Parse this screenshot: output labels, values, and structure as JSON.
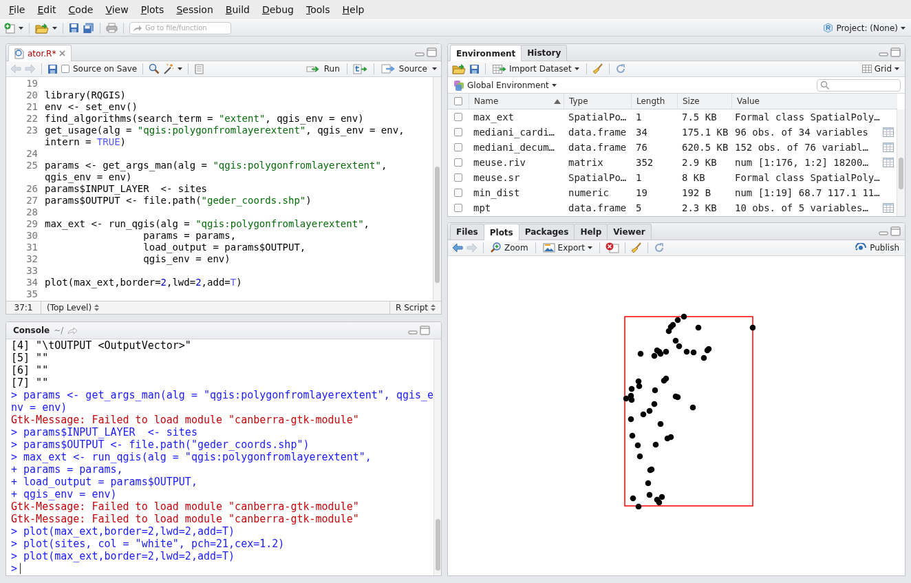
{
  "menu": [
    "File",
    "Edit",
    "Code",
    "View",
    "Plots",
    "Session",
    "Build",
    "Debug",
    "Tools",
    "Help"
  ],
  "main_toolbar": {
    "goto_placeholder": "Go to file/function",
    "project": "Project: (None)"
  },
  "editor": {
    "tabs": [
      {
        "label": "ator.R*",
        "selected": true,
        "modified": true
      }
    ],
    "back_disabled": true,
    "forward_disabled": true,
    "source_on_save": {
      "label": "Source on Save",
      "checked": false
    },
    "run_label": "Run",
    "source_label": "Source",
    "lines": [
      {
        "number": "19"
      },
      {
        "number": "20",
        "segments": [
          {
            "kind": "plain",
            "text": "library(RQGIS)"
          }
        ]
      },
      {
        "number": "21",
        "segments": [
          {
            "kind": "plain",
            "text": "env <- set_env()"
          }
        ]
      },
      {
        "number": "22",
        "segments": [
          {
            "kind": "plain",
            "text": "find_algorithms(search_term = "
          },
          {
            "kind": "string",
            "text": "\"extent\""
          },
          {
            "kind": "plain",
            "text": ", qgis_env = env)"
          }
        ]
      },
      {
        "number": "23",
        "segments": [
          {
            "kind": "plain",
            "text": "get_usage(alg = "
          },
          {
            "kind": "string",
            "text": "\"qgis:polygonfromlayerextent\""
          },
          {
            "kind": "plain",
            "text": ", qgis_env = env, intern = "
          },
          {
            "kind": "constant",
            "text": "TRUE"
          },
          {
            "kind": "plain",
            "text": ")"
          }
        ]
      },
      {
        "number": "24"
      },
      {
        "number": "25",
        "segments": [
          {
            "kind": "plain",
            "text": "params <- get_args_man(alg = "
          },
          {
            "kind": "string",
            "text": "\"qgis:polygonfromlayerextent\""
          },
          {
            "kind": "plain",
            "text": ", qgis_env = env)"
          }
        ]
      },
      {
        "number": "26",
        "segments": [
          {
            "kind": "plain",
            "text": "params$INPUT_LAYER  <- sites"
          }
        ]
      },
      {
        "number": "27",
        "segments": [
          {
            "kind": "plain",
            "text": "params$OUTPUT <- file.path("
          },
          {
            "kind": "string",
            "text": "\"geder_coords.shp\""
          },
          {
            "kind": "plain",
            "text": ")"
          }
        ]
      },
      {
        "number": "28"
      },
      {
        "number": "29",
        "segments": [
          {
            "kind": "plain",
            "text": "max_ext <- run_qgis(alg = "
          },
          {
            "kind": "string",
            "text": "\"qgis:polygonfromlayerextent\""
          },
          {
            "kind": "plain",
            "text": ","
          }
        ]
      },
      {
        "number": "30",
        "segments": [
          {
            "kind": "plain",
            "text": "                 params = params,"
          }
        ]
      },
      {
        "number": "31",
        "segments": [
          {
            "kind": "plain",
            "text": "                 load_output = params$OUTPUT,"
          }
        ]
      },
      {
        "number": "32",
        "segments": [
          {
            "kind": "plain",
            "text": "                 qgis_env = env)"
          }
        ]
      },
      {
        "number": "33"
      },
      {
        "number": "34",
        "segments": [
          {
            "kind": "plain",
            "text": "plot(max_ext,border="
          },
          {
            "kind": "number",
            "text": "2"
          },
          {
            "kind": "plain",
            "text": ",lwd="
          },
          {
            "kind": "number",
            "text": "2"
          },
          {
            "kind": "plain",
            "text": ",add="
          },
          {
            "kind": "constant",
            "text": "T"
          },
          {
            "kind": "plain",
            "text": ")"
          }
        ]
      },
      {
        "number": "35"
      }
    ],
    "status": {
      "position": "37:1",
      "scope": "(Top Level)",
      "file_type": "R Script"
    }
  },
  "console": {
    "title": "Console",
    "path": "~/",
    "lines": [
      {
        "kind": "output",
        "text": "[4] \"\\tOUTPUT <OutputVector>\""
      },
      {
        "kind": "output",
        "text": "[5] \"\""
      },
      {
        "kind": "output",
        "text": "[6] \"\""
      },
      {
        "kind": "output",
        "text": "[7] \"\""
      },
      {
        "kind": "input",
        "text": "> params <- get_args_man(alg = \"qgis:polygonfromlayerextent\", qgis_env = env)"
      },
      {
        "kind": "error",
        "text": "Gtk-Message: Failed to load module \"canberra-gtk-module\""
      },
      {
        "kind": "input",
        "text": "> params$INPUT_LAYER  <- sites"
      },
      {
        "kind": "input",
        "text": "> params$OUTPUT <- file.path(\"geder_coords.shp\")"
      },
      {
        "kind": "input",
        "text": "> max_ext <- run_qgis(alg = \"qgis:polygonfromlayerextent\","
      },
      {
        "kind": "input",
        "text": "+ params = params,"
      },
      {
        "kind": "input",
        "text": "+ load_output = params$OUTPUT,"
      },
      {
        "kind": "input",
        "text": "+ qgis_env = env)"
      },
      {
        "kind": "error",
        "text": "Gtk-Message: Failed to load module \"canberra-gtk-module\""
      },
      {
        "kind": "error",
        "text": "Gtk-Message: Failed to load module \"canberra-gtk-module\""
      },
      {
        "kind": "input",
        "text": "> plot(max_ext,border=2,lwd=2,add=T)"
      },
      {
        "kind": "input",
        "text": "> plot(sites, col = \"white\", pch=21,cex=1.2)"
      },
      {
        "kind": "input",
        "text": "> plot(max_ext,border=2,lwd=2,add=T)"
      },
      {
        "kind": "prompt",
        "text": ">"
      }
    ]
  },
  "environment": {
    "tabs": [
      {
        "label": "Environment",
        "selected": true
      },
      {
        "label": "History",
        "selected": false
      }
    ],
    "import_label": "Import Dataset",
    "view_label": "Grid",
    "scope_label": "Global Environment",
    "all_checked": false,
    "columns": [
      {
        "label": "Name",
        "sorted": true
      },
      {
        "label": "Type"
      },
      {
        "label": "Length"
      },
      {
        "label": "Size"
      },
      {
        "label": "Value"
      }
    ],
    "rows": [
      {
        "name": "max_ext",
        "type": "SpatialPo…",
        "length": "1",
        "size": "7.5 KB",
        "value": "Formal class SpatialPoly…",
        "checked": false,
        "viewable": false
      },
      {
        "name": "mediani_cardi…",
        "type": "data.frame",
        "length": "34",
        "size": "175.1 KB",
        "value": "96 obs. of 34 variables",
        "checked": false,
        "viewable": true
      },
      {
        "name": "mediani_decum…",
        "type": "data.frame",
        "length": "76",
        "size": "620.5 KB",
        "value": "152 obs. of 76 variabl…",
        "checked": false,
        "viewable": true
      },
      {
        "name": "meuse.riv",
        "type": "matrix",
        "length": "352",
        "size": "2.9 KB",
        "value": "num [1:176, 1:2] 18200…",
        "checked": false,
        "viewable": true
      },
      {
        "name": "meuse.sr",
        "type": "SpatialPo…",
        "length": "1",
        "size": "8 KB",
        "value": "Formal class SpatialPoly…",
        "checked": false,
        "viewable": false
      },
      {
        "name": "min_dist",
        "type": "numeric",
        "length": "19",
        "size": "192 B",
        "value": "num [1:19] 68.7 117.1 11…",
        "checked": false,
        "viewable": false
      },
      {
        "name": "mpt",
        "type": "data.frame",
        "length": "5",
        "size": "2.3 KB",
        "value": "10 obs. of 5 variables…",
        "checked": false,
        "viewable": true
      }
    ]
  },
  "output": {
    "tabs": [
      {
        "label": "Files",
        "selected": false
      },
      {
        "label": "Plots",
        "selected": true
      },
      {
        "label": "Packages",
        "selected": false
      },
      {
        "label": "Help",
        "selected": false
      },
      {
        "label": "Viewer",
        "selected": false
      }
    ],
    "back_disabled": false,
    "forward_disabled": true,
    "zoom_label": "Zoom",
    "export_label": "Export",
    "publish_label": "Publish"
  }
}
